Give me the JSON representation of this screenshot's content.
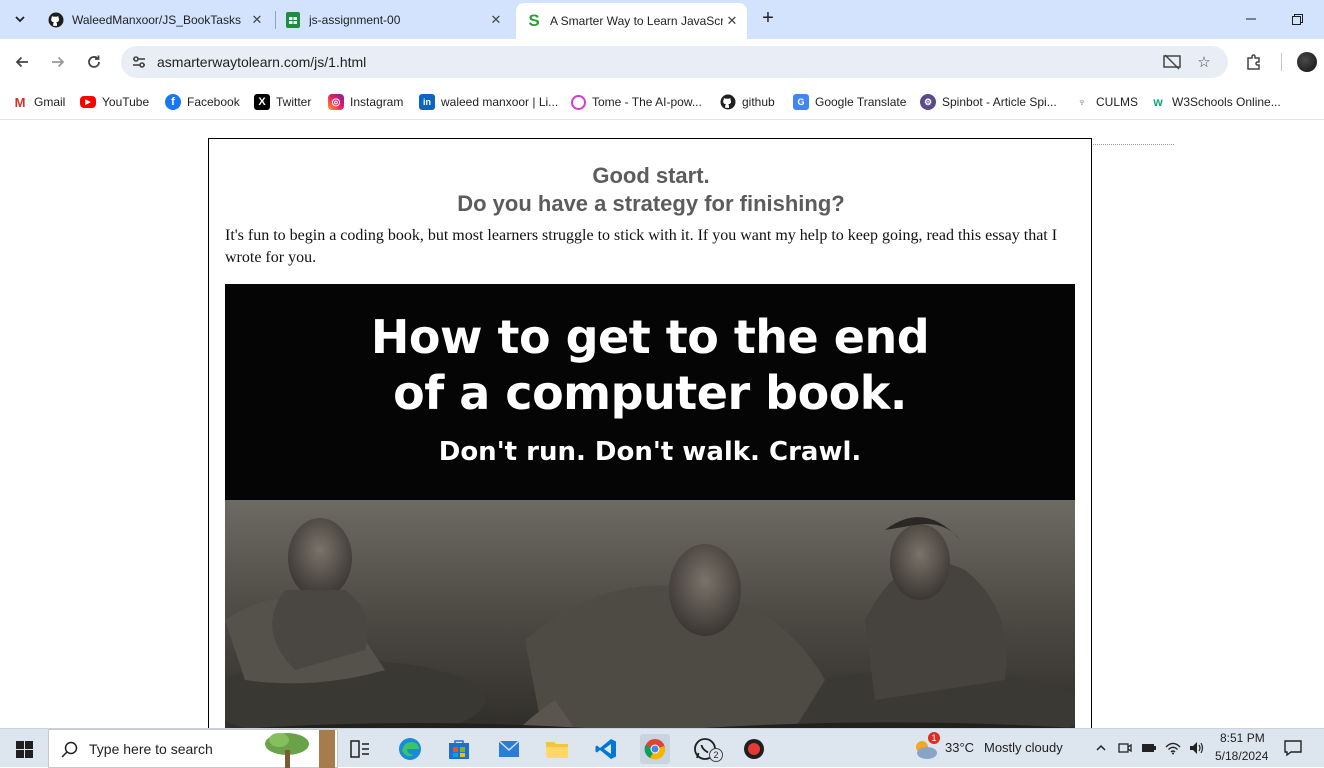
{
  "tabs": [
    {
      "title": "WaleedManxoor/JS_BookTasks",
      "icon": "github-icon"
    },
    {
      "title": "js-assignment-00",
      "icon": "sheets-icon"
    },
    {
      "title": "A Smarter Way to Learn JavaScript",
      "icon": "asmarterway-icon"
    }
  ],
  "address_bar": {
    "url": "asmarterwaytolearn.com/js/1.html"
  },
  "bookmarks": [
    {
      "label": "Gmail"
    },
    {
      "label": "YouTube"
    },
    {
      "label": "Facebook"
    },
    {
      "label": "Twitter"
    },
    {
      "label": "Instagram"
    },
    {
      "label": "waleed manxoor | Li..."
    },
    {
      "label": "Tome - The AI-pow..."
    },
    {
      "label": "github"
    },
    {
      "label": "Google Translate"
    },
    {
      "label": "Spinbot - Article Spi..."
    },
    {
      "label": "CULMS"
    },
    {
      "label": "W3Schools Online..."
    }
  ],
  "content": {
    "heading_line1": "Good start.",
    "heading_line2": "Do you have a strategy for finishing?",
    "intro": "It's fun to begin a coding book, but most learners struggle to stick with it. If you want my help to keep going, read this essay that I wrote for you.",
    "banner": {
      "title_line1": "How to get to the end",
      "title_line2": "of a computer book.",
      "subtitle": "Don't run. Don't walk. Crawl."
    }
  },
  "taskbar": {
    "search_placeholder": "Type here to search",
    "weather_temp": "33°C",
    "weather_desc": "Mostly cloudy",
    "weather_alert": "1",
    "whatsapp_badge": "2",
    "time": "8:51 PM",
    "date": "5/18/2024"
  },
  "colors": {
    "tabstrip": "#d3e3fd",
    "omnibox": "#e9eef6",
    "heading": "#5c5c5c",
    "banner_bg": "#050505",
    "taskbar": "#dde6ef"
  }
}
